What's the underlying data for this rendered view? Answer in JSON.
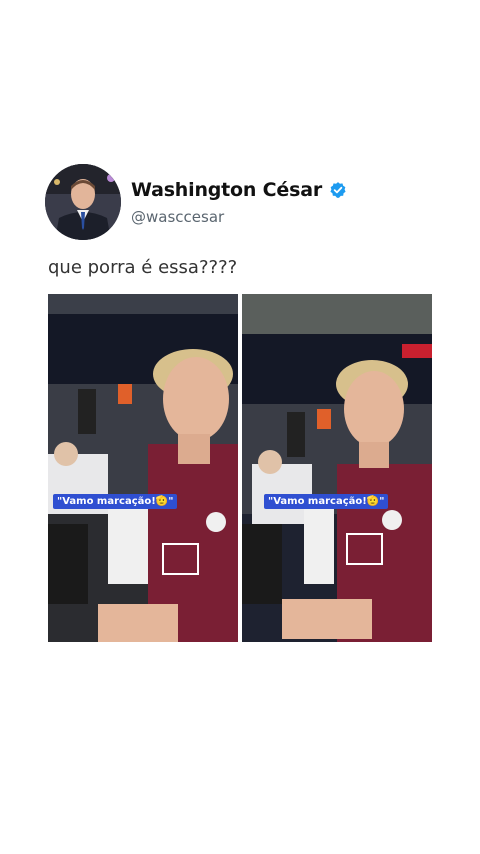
{
  "tweet": {
    "display_name": "Washington César",
    "handle": "@wasccesar",
    "text": "que porra é essa????",
    "verified": true,
    "verified_color": "#1d9bf0"
  },
  "media": [
    {
      "caption": "\"Vamo marcação!🫡\""
    },
    {
      "caption": "\"Vamo marcação!🫡\""
    }
  ],
  "icons": [
    "avatar",
    "verified-badge-icon"
  ]
}
